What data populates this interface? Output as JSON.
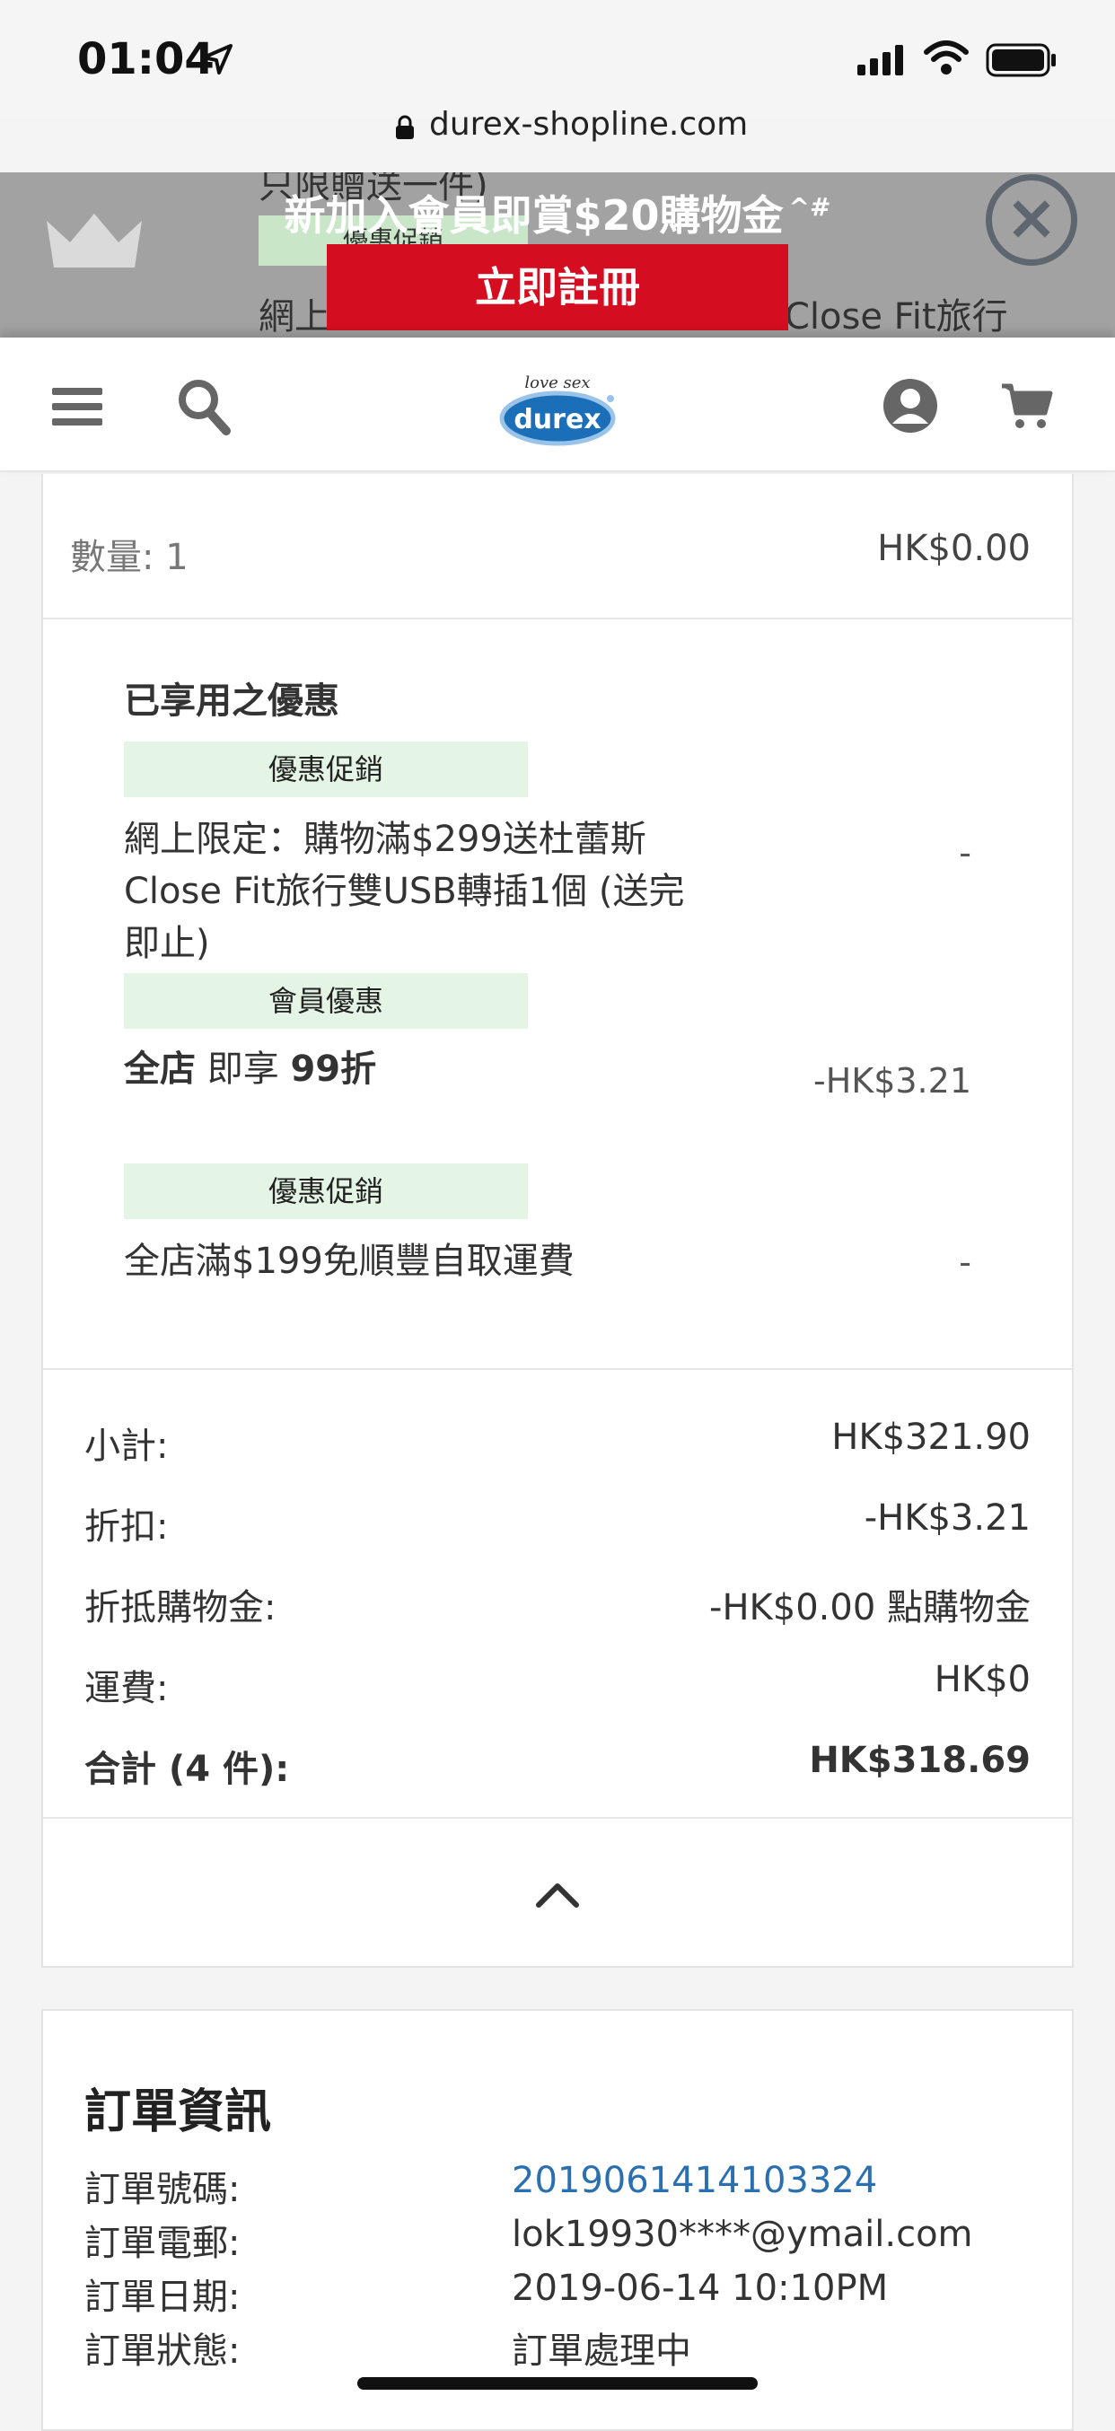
{
  "status_bar": {
    "time": "01:04"
  },
  "browser": {
    "url": "durex-shopline.com"
  },
  "banner": {
    "text": "新加入會員即賞$20購物金",
    "sup": "^#",
    "button_label": "立即註冊",
    "behind_line1": "只限贈送一件)",
    "behind_tag": "優惠促銷",
    "behind_line2_left": "網上",
    "behind_line2_right": "Close Fit旅行"
  },
  "logo": {
    "top": "love sex",
    "brand": "durex"
  },
  "order": {
    "quantity_label": "數量: 1",
    "quantity_price": "HK$0.00",
    "promotions_title": "已享用之優惠",
    "promotions": [
      {
        "tag": "優惠促銷",
        "text": "網上限定：購物滿$299送杜蕾斯Close Fit旅行雙USB轉插1個 (送完即止)",
        "amount": "-"
      },
      {
        "tag": "會員優惠",
        "text_prefix": "全店",
        "text_mid": " 即享 ",
        "text_bold": "99折",
        "amount": "-HK$3.21"
      },
      {
        "tag": "優惠促銷",
        "text": "全店滿$199免順豐自取運費",
        "amount": "-"
      }
    ],
    "summary": {
      "subtotal_label": "小計:",
      "subtotal_value": "HK$321.90",
      "discount_label": "折扣:",
      "discount_value": "-HK$3.21",
      "credit_label": "折抵購物金:",
      "credit_value": "-HK$0.00 點購物金",
      "shipping_label": "運費:",
      "shipping_value": "HK$0",
      "total_label": "合計 (4 件):",
      "total_value": "HK$318.69"
    }
  },
  "order_info": {
    "title": "訂單資訊",
    "number_label": "訂單號碼:",
    "number_value": "2019061414103324",
    "email_label": "訂單電郵:",
    "email_value": "lok19930****@ymail.com",
    "date_label": "訂單日期:",
    "date_value": "2019-06-14 10:10PM",
    "status_label": "訂單狀態:",
    "status_value": "訂單處理中"
  },
  "colors": {
    "accent_red": "#d40e20",
    "tag_green": "#e5f5e5",
    "link_blue": "#2a6fb0",
    "durex_blue": "#1b6fb8"
  }
}
